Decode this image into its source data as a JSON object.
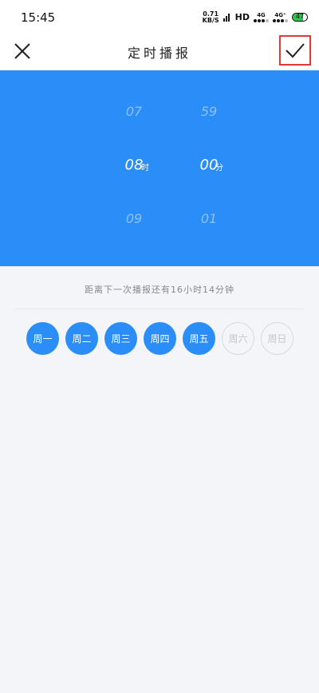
{
  "status_bar": {
    "time": "15:45",
    "speed_value": "0.71",
    "speed_unit": "KB/S",
    "hd_label": "HD",
    "sim1_label": "4G",
    "sim2_label": "4G⁺",
    "battery": "47"
  },
  "header": {
    "title": "定时播报"
  },
  "picker": {
    "hours": {
      "prev": "07",
      "selected": "08",
      "next": "09",
      "unit": "时"
    },
    "minutes": {
      "prev": "59",
      "selected": "00",
      "next": "01",
      "unit": "分"
    }
  },
  "next_broadcast_text": "距离下一次播报还有16小时14分钟",
  "days": [
    {
      "label": "周一",
      "selected": true
    },
    {
      "label": "周二",
      "selected": true
    },
    {
      "label": "周三",
      "selected": true
    },
    {
      "label": "周四",
      "selected": true
    },
    {
      "label": "周五",
      "selected": true
    },
    {
      "label": "周六",
      "selected": false
    },
    {
      "label": "周日",
      "selected": false
    }
  ],
  "colors": {
    "accent": "#2b8ef8",
    "highlight_border": "#e53935"
  }
}
